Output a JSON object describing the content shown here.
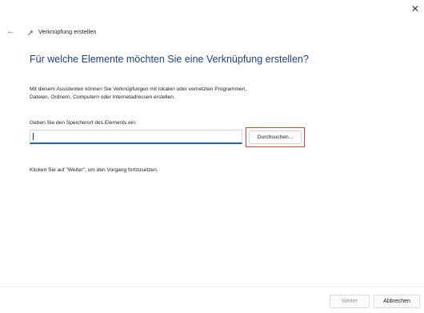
{
  "window": {
    "close_icon": "close-icon",
    "back_icon": "back-arrow-icon",
    "wizard_icon": "shortcut-wizard-icon",
    "title": "Verknüpfung erstellen"
  },
  "page": {
    "heading": "Für welche Elemente möchten Sie eine Verknüpfung erstellen?",
    "intro_line1": "Mit diesem Assistenten können Sie Verknüpfungen mit lokalen oder vernetzten Programmen,",
    "intro_line2": "Dateien, Ordnern, Computern oder Internetadressen erstellen.",
    "location_label": "Geben Sie den Speicherort des Elements ein:",
    "location_value": "",
    "browse_label": "Durchsuchen...",
    "hint": "Klicken Sie auf \"Weiter\", um den Vorgang fortzusetzen.",
    "highlight_color": "#e0412d",
    "accent_color": "#1e3f8a"
  },
  "footer": {
    "next_label": "Weiter",
    "next_enabled": false,
    "cancel_label": "Abbrechen"
  }
}
